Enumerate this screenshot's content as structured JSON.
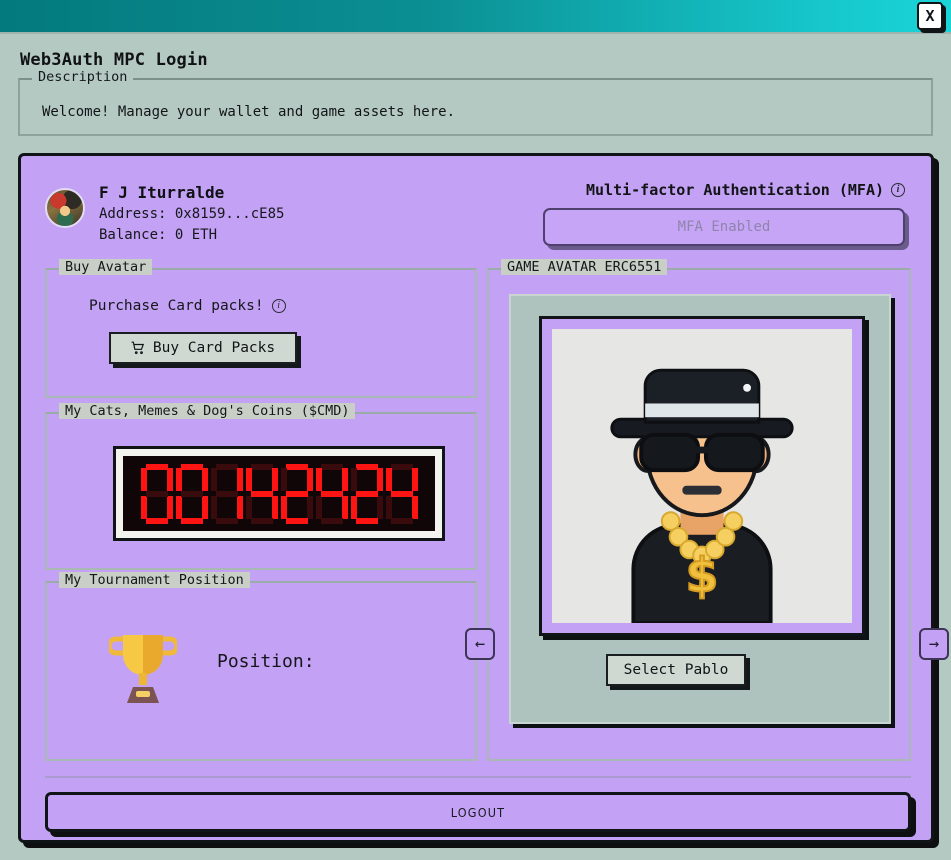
{
  "window": {
    "title": "Web3Auth MPC Login",
    "close_label": "X",
    "accent_gradient_start": "#037a7d",
    "accent_gradient_end": "#1ad4d8",
    "panel_color": "#c3a1f5",
    "app_background": "#b5c9c3"
  },
  "description": {
    "legend": "Description",
    "text": "Welcome! Manage your wallet and game assets here."
  },
  "profile": {
    "avatar_icon": "user-avatar-thumbnail",
    "name": "F J Iturralde",
    "address": "Address: 0x8159...cE85",
    "balance": "Balance: 0 ETH"
  },
  "mfa": {
    "label": "Multi-factor Authentication (MFA)",
    "info_icon": "info-icon",
    "button_label": "MFA Enabled",
    "enabled": true
  },
  "buy_avatar": {
    "legend": "Buy Avatar",
    "prompt": "Purchase Card packs!",
    "info_icon": "info-icon",
    "button_label": "Buy Card Packs",
    "button_icon": "shopping-cart-icon"
  },
  "coins": {
    "legend": "My Cats, Memes & Dog's Coins ($CMD)",
    "display_value": "00142424",
    "digit_count": 8,
    "led_on_color": "#ff1414",
    "led_off_color": "#3a0b0c",
    "led_background": "#100607"
  },
  "tournament": {
    "legend": "My Tournament Position",
    "trophy_icon": "trophy-icon",
    "label": "Position:",
    "value": ""
  },
  "game_avatar": {
    "legend": "GAME AVATAR ERC6551",
    "character_name": "Pablo",
    "avatar_icon": "gangster-avatar-icon",
    "select_button_label": "Select Pablo",
    "prev_arrow_label": "←",
    "next_arrow_label": "→",
    "prev_arrow_icon": "arrow-left-icon",
    "next_arrow_icon": "arrow-right-icon"
  },
  "footer": {
    "logout_label": "LOGOUT"
  }
}
